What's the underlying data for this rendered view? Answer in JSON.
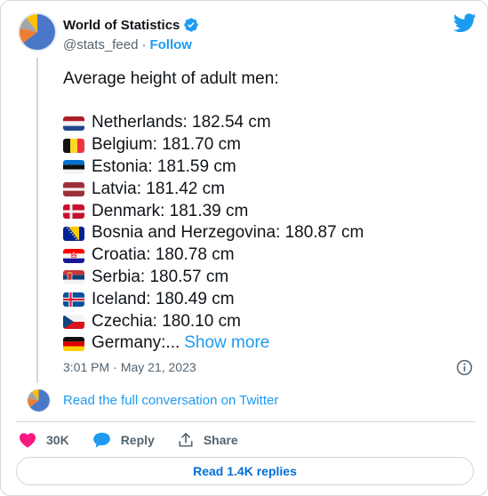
{
  "author": {
    "display_name": "World of Statistics",
    "handle": "@stats_feed",
    "separator": "·",
    "follow_label": "Follow"
  },
  "tweet": {
    "intro": "Average height of adult men:",
    "countries": [
      {
        "flag": "netherlands-flag-icon",
        "text": "Netherlands: 182.54 cm"
      },
      {
        "flag": "belgium-flag-icon",
        "text": "Belgium: 181.70 cm"
      },
      {
        "flag": "estonia-flag-icon",
        "text": "Estonia: 181.59 cm"
      },
      {
        "flag": "latvia-flag-icon",
        "text": "Latvia: 181.42 cm"
      },
      {
        "flag": "denmark-flag-icon",
        "text": "Denmark: 181.39 cm"
      },
      {
        "flag": "bosnia-flag-icon",
        "text": "Bosnia and Herzegovina: 180.87 cm"
      },
      {
        "flag": "croatia-flag-icon",
        "text": "Croatia: 180.78 cm"
      },
      {
        "flag": "serbia-flag-icon",
        "text": "Serbia: 180.57 cm"
      },
      {
        "flag": "iceland-flag-icon",
        "text": "Iceland: 180.49 cm"
      },
      {
        "flag": "czechia-flag-icon",
        "text": "Czechia: 180.10 cm"
      },
      {
        "flag": "germany-flag-icon",
        "text": "Germany:..."
      }
    ],
    "show_more_label": "Show more",
    "time": "3:01 PM",
    "date": "May 21, 2023",
    "separator": "·"
  },
  "conversation_link": "Read the full conversation on Twitter",
  "actions": {
    "likes": "30K",
    "reply_label": "Reply",
    "share_label": "Share"
  },
  "read_replies_label": "Read 1.4K replies",
  "colors": {
    "accent": "#1d9bf0",
    "like": "#f91880",
    "muted_text": "#536471",
    "border": "#cfd9de"
  }
}
